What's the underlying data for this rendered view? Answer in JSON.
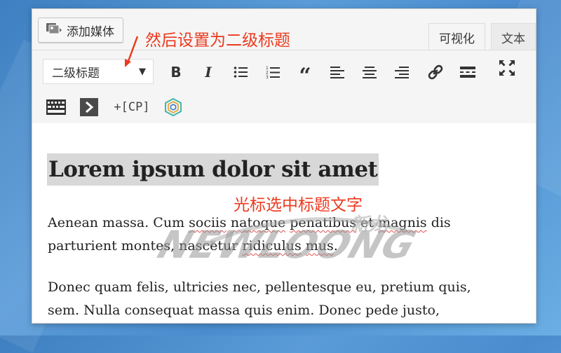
{
  "editor": {
    "media_button": {
      "label": "添加媒体",
      "icon": "media-icon"
    },
    "tabs": [
      {
        "label": "可视化",
        "active": true
      },
      {
        "label": "文本",
        "active": false
      }
    ],
    "format_select": {
      "value": "二级标题"
    },
    "toolbar_row1": [
      {
        "name": "bold-icon"
      },
      {
        "name": "italic-icon"
      },
      {
        "name": "bullet-list-icon"
      },
      {
        "name": "numbered-list-icon"
      },
      {
        "name": "blockquote-icon"
      },
      {
        "name": "align-left-icon"
      },
      {
        "name": "align-center-icon"
      },
      {
        "name": "align-right-icon"
      },
      {
        "name": "link-icon"
      },
      {
        "name": "read-more-icon"
      },
      {
        "name": "fullscreen-icon"
      }
    ],
    "toolbar_row2": {
      "kitchen_sink": "keyboard-icon",
      "shortcode": "chevron-right-icon",
      "cp_label": "+[CP]",
      "plugin": "hexagon-logo-icon"
    },
    "content": {
      "heading": "Lorem ipsum dolor sit amet",
      "paragraph1": {
        "before": "Aenean massa. Cum ",
        "spell1": "sociis",
        "mid1": " ",
        "spell2": "natoque",
        "mid2": " ",
        "spell3": "penatibus",
        "mid3": " et ",
        "spell4": "magnis",
        "mid4": " dis ",
        "line2a": "parturient montes, nascetur ",
        "spell5": "ridiculus",
        "mid5": " ",
        "spell6": "mus",
        "end": "."
      },
      "paragraph2_line1": "Donec quam felis, ultricies nec, pellentesque eu, pretium quis,",
      "paragraph2_line2": "sem. Nulla consequat massa quis enim. Donec pede justo,"
    }
  },
  "annotations": {
    "top": "然后设置为二级标题",
    "middle": "光标选中标题文字",
    "color": "#ec3a1f"
  },
  "watermark": {
    "text": "NEWLOONG",
    "cn": "新龙"
  }
}
